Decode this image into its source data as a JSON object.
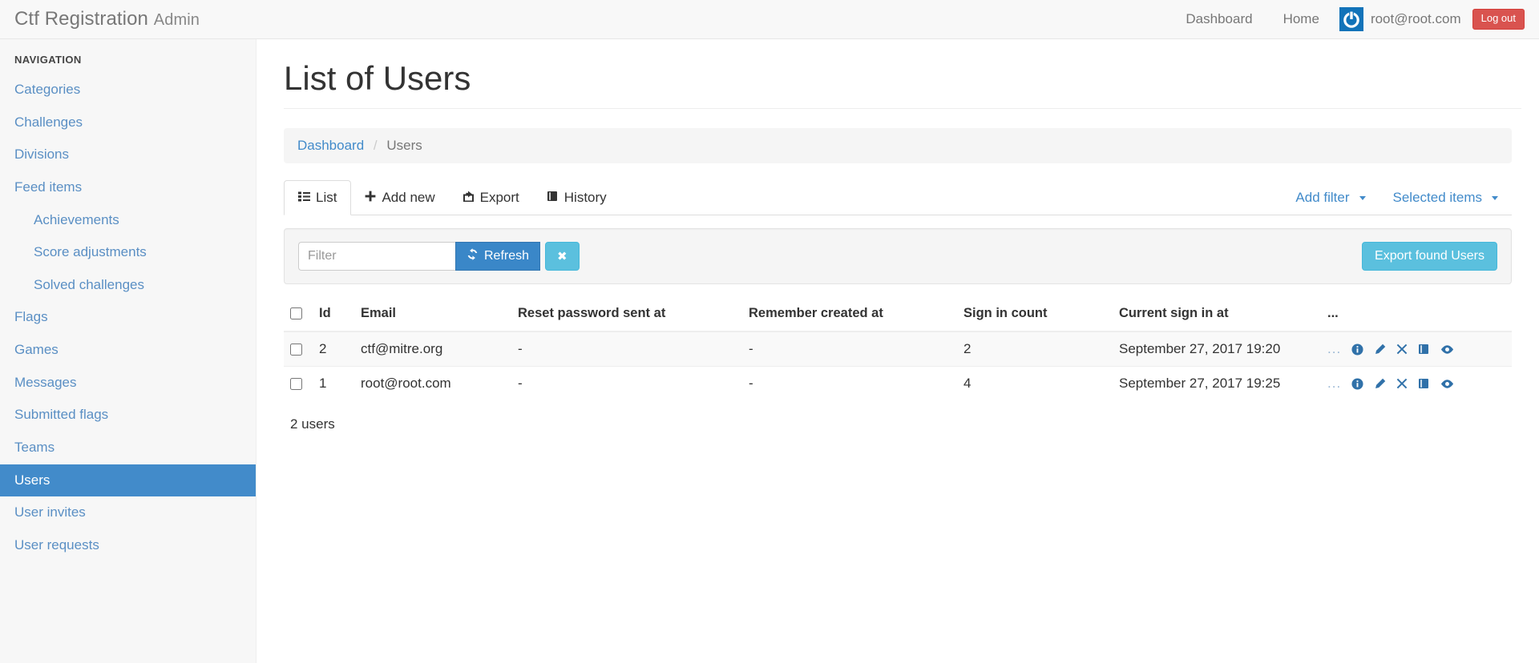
{
  "navbar": {
    "brand_main": "Ctf Registration",
    "brand_sub": "Admin",
    "links": [
      {
        "label": "Dashboard"
      },
      {
        "label": "Home"
      }
    ],
    "user_email": "root@root.com",
    "logout_label": "Log out",
    "gravatar_icon": "power-icon",
    "gravatar_color": "#1273b9",
    "logout_color": "#d9534f"
  },
  "sidebar": {
    "header": "NAVIGATION",
    "items": [
      {
        "label": "Categories",
        "sub": false,
        "active": false
      },
      {
        "label": "Challenges",
        "sub": false,
        "active": false
      },
      {
        "label": "Divisions",
        "sub": false,
        "active": false
      },
      {
        "label": "Feed items",
        "sub": false,
        "active": false
      },
      {
        "label": "Achievements",
        "sub": true,
        "active": false
      },
      {
        "label": "Score adjustments",
        "sub": true,
        "active": false
      },
      {
        "label": "Solved challenges",
        "sub": true,
        "active": false
      },
      {
        "label": "Flags",
        "sub": false,
        "active": false
      },
      {
        "label": "Games",
        "sub": false,
        "active": false
      },
      {
        "label": "Messages",
        "sub": false,
        "active": false
      },
      {
        "label": "Submitted flags",
        "sub": false,
        "active": false
      },
      {
        "label": "Teams",
        "sub": false,
        "active": false
      },
      {
        "label": "Users",
        "sub": false,
        "active": true
      },
      {
        "label": "User invites",
        "sub": false,
        "active": false
      },
      {
        "label": "User requests",
        "sub": false,
        "active": false
      }
    ],
    "active_color": "#428bca",
    "link_color": "#5a8fc4"
  },
  "main": {
    "page_title": "List of Users",
    "breadcrumb": {
      "root": "Dashboard",
      "separator": "/",
      "current": "Users"
    },
    "tabs": [
      {
        "label": "List",
        "icon": "list-icon",
        "active": true
      },
      {
        "label": "Add new",
        "icon": "plus-icon",
        "active": false
      },
      {
        "label": "Export",
        "icon": "export-icon",
        "active": false
      },
      {
        "label": "History",
        "icon": "book-icon",
        "active": false
      }
    ],
    "tabs_right": [
      {
        "label": "Add filter",
        "icon": "chevron-down-icon"
      },
      {
        "label": "Selected items",
        "icon": "chevron-down-icon"
      }
    ],
    "filter": {
      "placeholder": "Filter",
      "value": "",
      "refresh_label": "Refresh",
      "refresh_icon": "refresh-icon",
      "clear_icon": "close-icon",
      "export_found_label": "Export found Users",
      "refresh_color": "#3a87c8",
      "accent_color": "#5bc0de"
    },
    "table": {
      "headers": [
        "Id",
        "Email",
        "Reset password sent at",
        "Remember created at",
        "Sign in count",
        "Current sign in at",
        "..."
      ],
      "rows": [
        {
          "id": "2",
          "email": "ctf@mitre.org",
          "reset_password_sent_at": "-",
          "remember_created_at": "-",
          "sign_in_count": "2",
          "current_sign_in_at": "September 27, 2017 19:20",
          "actions_dots": "..."
        },
        {
          "id": "1",
          "email": "root@root.com",
          "reset_password_sent_at": "-",
          "remember_created_at": "-",
          "sign_in_count": "4",
          "current_sign_in_at": "September 27, 2017 19:25",
          "actions_dots": "..."
        }
      ],
      "row_action_icons": [
        "info-icon",
        "edit-pencil-icon",
        "delete-x-icon",
        "history-book-icon",
        "show-eye-icon"
      ],
      "action_icon_color": "#3071a9"
    },
    "count_note": "2 users"
  }
}
